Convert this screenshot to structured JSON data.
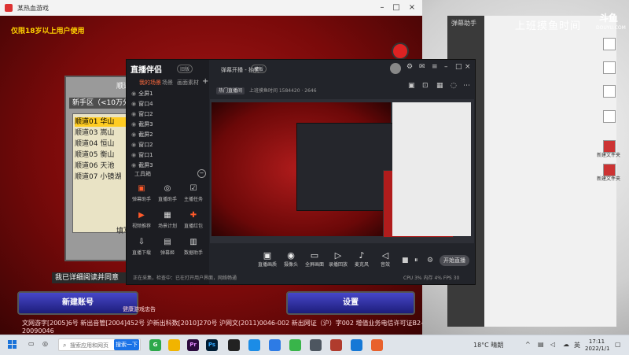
{
  "game": {
    "title": "某热血游戏",
    "warning": "仅限18岁以上用户使用",
    "server_header": "新手区（<10万分",
    "servers": [
      "顺道01 华山",
      "顺道03 嵩山",
      "顺道04 恒山",
      "顺道05 衡山",
      "顺道06 天池",
      "顺道07 小镜湖"
    ],
    "agree_text": "我已详细阅读并同意",
    "new_account_btn": "新建账号",
    "settings_btn": "设置",
    "footer_notice": "健康游戏忠告",
    "footer": "文网游字[2005]6号 新出音管[2004]452号 沪新出科数[2010]270号 沪网文(2011)0046-002 新出网证（沪）字002 增值业务电信许可证B2-20090046",
    "server_partial": "顺道",
    "fill_label": "填写"
  },
  "live": {
    "logo": "直播伴侣",
    "version": "旧版",
    "tabs": [
      "我的场景",
      "场景",
      "画面素材"
    ],
    "sources": [
      "全屏1",
      "窗口4",
      "窗口2",
      "截屏3",
      "截屏2",
      "窗口2",
      "窗口1",
      "截屏3"
    ],
    "tools_label": "工具箱",
    "tools": [
      {
        "label": "弹幕助手",
        "icon": "chat-icon",
        "accent": true
      },
      {
        "label": "直播助手",
        "icon": "user-icon",
        "accent": false
      },
      {
        "label": "主播任务",
        "icon": "task-icon",
        "accent": false
      },
      {
        "label": "视频推荐",
        "icon": "video-icon",
        "accent": true
      },
      {
        "label": "场景计划",
        "icon": "calendar-icon",
        "accent": false
      },
      {
        "label": "直播红包",
        "icon": "gift-icon",
        "accent": true
      },
      {
        "label": "直播下载",
        "icon": "download-icon",
        "accent": false
      },
      {
        "label": "弹幕姬",
        "icon": "comment-icon",
        "accent": false
      },
      {
        "label": "数据助手",
        "icon": "data-icon",
        "accent": false
      }
    ],
    "room_title": "弹幕开播 - 抽奖",
    "room_mode": "模板",
    "info_tag": "热门直播间",
    "info_text": "上班摸鱼时间 1584420 · 2646",
    "bottom_buttons": [
      {
        "label": "直播画质",
        "icon": "quality-icon"
      },
      {
        "label": "摄像头",
        "icon": "camera-icon"
      },
      {
        "label": "全屏画面",
        "icon": "screen-icon"
      },
      {
        "label": "录播回放",
        "icon": "play-icon"
      },
      {
        "label": "麦克风",
        "icon": "mic-icon"
      },
      {
        "label": "音效",
        "icon": "speaker-icon"
      }
    ],
    "start_live": "开始直播",
    "status": "正在采集，检查中：已在打开用户界面，网络畅通",
    "stats": "CPU 3% 内存 4% FPS 30"
  },
  "stream_room": {
    "label": "弹幕助手",
    "title": "上班摸鱼时间",
    "brand": "斗鱼",
    "brand_sub": "DOUYU.COM"
  },
  "desktop_icons": [
    {
      "label": ""
    },
    {
      "label": ""
    },
    {
      "label": ""
    },
    {
      "label": ""
    },
    {
      "label": "新建文件夹"
    },
    {
      "label": "新建文件夹"
    }
  ],
  "taskbar": {
    "search_placeholder": "搜索应用和网页",
    "search_button": "搜索一下",
    "apps": [
      "G",
      "",
      "Pr",
      "Ps",
      "",
      "",
      "",
      "",
      "",
      "",
      "",
      ""
    ],
    "weather": "18°C 晴朗",
    "lang": "英",
    "time": "17:11",
    "date": "2022/1/1"
  }
}
